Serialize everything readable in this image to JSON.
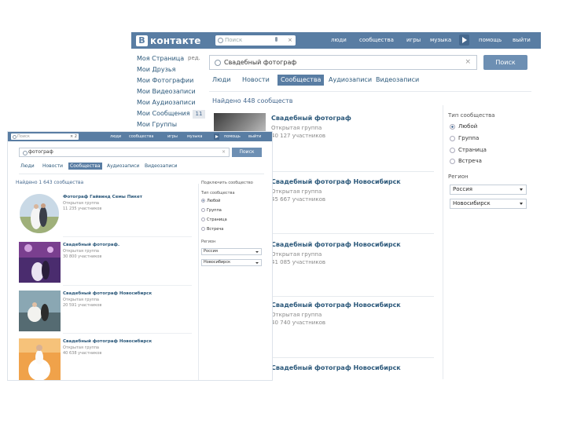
{
  "back_window": {
    "logo": {
      "letter": "В",
      "text": "контакте"
    },
    "top_search_placeholder": "Поиск",
    "top_search_close": "×",
    "topnav": [
      "люди",
      "сообщества",
      "игры",
      "музыка",
      "помощь",
      "выйти"
    ],
    "sidebar": {
      "items": [
        "Моя Страница",
        "Мои Друзья",
        "Мои Фотографии",
        "Мои Видеозаписи",
        "Мои Аудиозаписи",
        "Мои Сообщения",
        "Мои Группы"
      ],
      "edit": "ред.",
      "messages_count": "11"
    },
    "search_query": "Свадебный фотограф",
    "search_clear": "×",
    "search_button": "Поиск",
    "tabs": [
      "Люди",
      "Новости",
      "Сообщества",
      "Аудиозаписи",
      "Видеозаписи"
    ],
    "found": "Найдено 448 сообществ",
    "results": [
      {
        "title": "Свадебный фотограф",
        "subtitle": "Открытая группа",
        "count": "40 127 участников"
      },
      {
        "title": "Свадебный фотограф Новосибирск",
        "subtitle": "Открытая группа",
        "count": "45 667 участников"
      },
      {
        "title": "Свадебный фотограф Новосибирск",
        "subtitle": "Открытая группа",
        "count": "41 085 участников"
      },
      {
        "title": "Свадебный фотограф Новосибирск",
        "subtitle": "Открытая группа",
        "count": "40 740 участников"
      },
      {
        "title": "Свадебный фотограф Новосибирск",
        "subtitle": "",
        "count": ""
      }
    ],
    "filter": {
      "type_heading": "Тип сообщества",
      "types": [
        "Любой",
        "Группа",
        "Страница",
        "Встреча"
      ],
      "region_heading": "Регион",
      "country": "Россия",
      "city": "Новосибирск"
    }
  },
  "front_window": {
    "top_search_placeholder": "Поиск",
    "top_search_close": "× 2",
    "topnav": [
      "люди",
      "сообщества",
      "игры",
      "музыка",
      "помощь",
      "выйти"
    ],
    "search_query": "фотограф",
    "search_clear": "×",
    "search_button": "Поиск",
    "tabs": [
      "Люди",
      "Новости",
      "Сообщества",
      "Аудиозаписи",
      "Видеозаписи"
    ],
    "found": "Найдено 1 643 сообщества",
    "results": [
      {
        "title": "Фотограф Гайвинд Семы Пикет",
        "subtitle": "Открытая группа",
        "count": "11 235 участников"
      },
      {
        "title": "Свадебный фотограф.",
        "subtitle": "Открытая группа",
        "count": "30 800 участников"
      },
      {
        "title": "Свадебный фотограф Новосибирск",
        "subtitle": "Открытая группа",
        "count": "20 591 участников"
      },
      {
        "title": "Свадебный фотограф Новосибирск",
        "subtitle": "Открытая группа",
        "count": "40 638 участников"
      }
    ],
    "filter": {
      "title": "Подключить сообщество",
      "type_heading": "Тип сообщества",
      "types": [
        "Любой",
        "Группа",
        "Страница",
        "Встреча"
      ],
      "region_heading": "Регион",
      "country": "Россия",
      "city": "Новосибирск"
    }
  },
  "colors": {
    "header": "#597da3",
    "link": "#2b587a",
    "button": "#6d8fb3"
  }
}
